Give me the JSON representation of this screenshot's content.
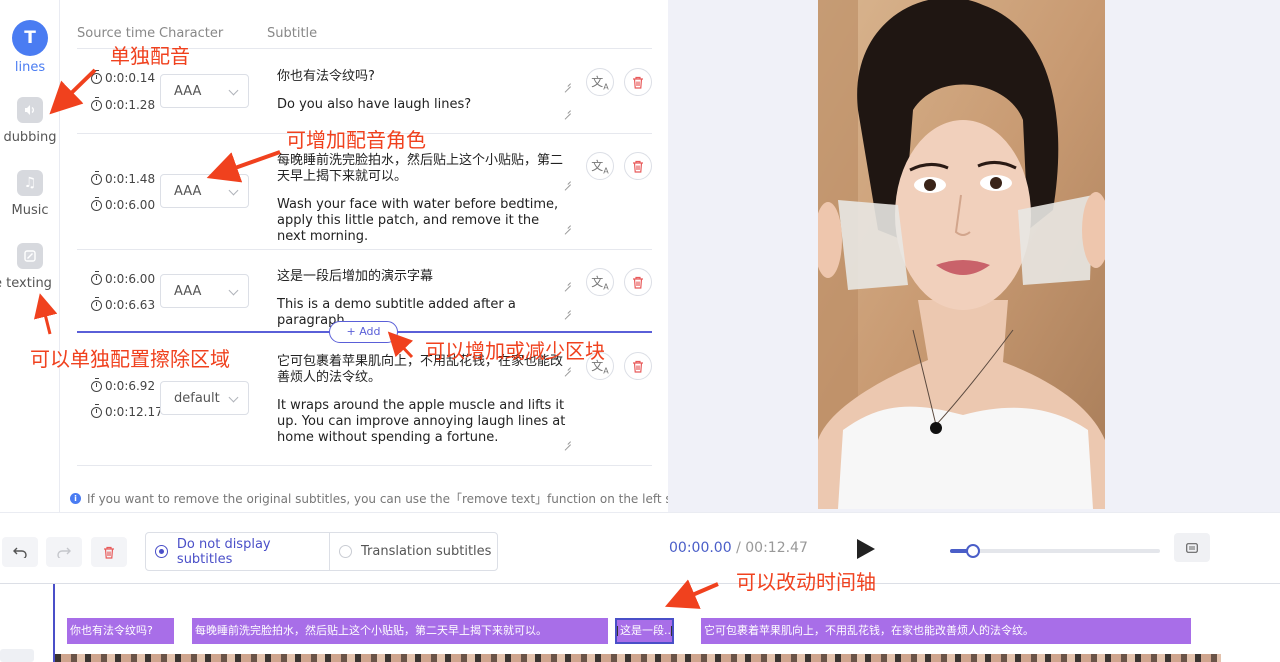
{
  "sidebar": {
    "items": [
      {
        "label": "lines",
        "icon": "text-icon",
        "glyph": "T",
        "active": true
      },
      {
        "label": "dubbing",
        "icon": "dubbing-icon",
        "glyph": "🔊"
      },
      {
        "label": "Music",
        "icon": "music-icon",
        "glyph": "♫"
      },
      {
        "label": "e texting",
        "icon": "remove-text-icon",
        "glyph": "⌧"
      }
    ]
  },
  "table": {
    "headers": {
      "source_time": "Source time",
      "character": "Character",
      "subtitle": "Subtitle"
    },
    "rows": [
      {
        "start": "0:0:0.14",
        "end": "0:0:1.28",
        "character": "AAA",
        "text_zh": "你也有法令纹吗?",
        "text_en": "Do you also have laugh lines?"
      },
      {
        "start": "0:0:1.48",
        "end": "0:0:6.00",
        "character": "AAA",
        "text_zh": "每晚睡前洗完脸拍水，然后贴上这个小贴贴，第二天早上揭下来就可以。",
        "text_en": "Wash your face with water before bedtime, apply this little patch, and remove it the next morning."
      },
      {
        "start": "0:0:6.00",
        "end": "0:0:6.63",
        "character": "AAA",
        "text_zh": "这是一段后增加的演示字幕",
        "text_en": "This is a demo subtitle added after a paragraph"
      },
      {
        "start": "0:0:6.92",
        "end": "0:0:12.17",
        "character": "default",
        "text_zh": "它可包裹着苹果肌向上，不用乱花钱，在家也能改善烦人的法令纹。",
        "text_en": "It wraps around the apple muscle and lifts it up. You can improve annoying laugh lines at home without spending a fortune."
      }
    ],
    "add_label": "+ Add",
    "hint": "If you want to remove the original subtitles, you can use the「remove text」function on the left side"
  },
  "toolbar": {
    "subtitle_options": [
      "Do not display subtitles",
      "Translation subtitles"
    ],
    "selected_option": 0,
    "current_time": "00:00.00",
    "separator": " / ",
    "total_time": "00:12.47",
    "progress": 0.11
  },
  "timeline": {
    "segments": [
      "你也有法令纹吗?",
      "每晚睡前洗完脸拍水，然后贴上这个小贴贴，第二天早上揭下来就可以。",
      "这是一段...",
      "它可包裹着苹果肌向上，不用乱花钱，在家也能改善烦人的法令纹。"
    ],
    "selected_segment": 2
  },
  "annotations": {
    "dubbing": "单独配音",
    "add_role": "可增加配音角色",
    "erase_region": "可以单独配置擦除区域",
    "add_block": "可以增加或减少区块",
    "timeline": "可以改动时间轴"
  },
  "colors": {
    "accent": "#4a4fc8",
    "segment": "#a86ee8",
    "annotation": "#f0411e",
    "rail_active": "#4a7cf2"
  }
}
